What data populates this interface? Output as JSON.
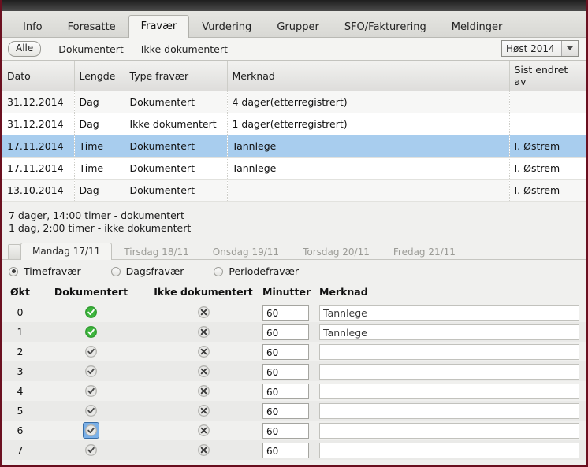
{
  "main_tabs": [
    {
      "label": "Info",
      "active": false
    },
    {
      "label": "Foresatte",
      "active": false
    },
    {
      "label": "Fravær",
      "active": true
    },
    {
      "label": "Vurdering",
      "active": false
    },
    {
      "label": "Grupper",
      "active": false
    },
    {
      "label": "SFO/Fakturering",
      "active": false
    },
    {
      "label": "Meldinger",
      "active": false
    }
  ],
  "filter": {
    "all_label": "Alle",
    "documented_label": "Dokumentert",
    "undocumented_label": "Ikke dokumentert",
    "season": "Høst 2014"
  },
  "grid": {
    "columns": [
      "Dato",
      "Lengde",
      "Type fravær",
      "Merknad",
      "Sist endret av"
    ],
    "rows": [
      {
        "dato": "31.12.2014",
        "lengde": "Dag",
        "type": "Dokumentert",
        "merknad": "4 dager(etterregistrert)",
        "endret": "",
        "selected": false
      },
      {
        "dato": "31.12.2014",
        "lengde": "Dag",
        "type": "Ikke dokumentert",
        "merknad": "1 dager(etterregistrert)",
        "endret": "",
        "selected": false
      },
      {
        "dato": "17.11.2014",
        "lengde": "Time",
        "type": "Dokumentert",
        "merknad": "Tannlege",
        "endret": "I. Østrem",
        "selected": true
      },
      {
        "dato": "17.11.2014",
        "lengde": "Time",
        "type": "Dokumentert",
        "merknad": "Tannlege",
        "endret": "I. Østrem",
        "selected": false
      },
      {
        "dato": "13.10.2014",
        "lengde": "Dag",
        "type": "Dokumentert",
        "merknad": "",
        "endret": "I. Østrem",
        "selected": false
      }
    ]
  },
  "summary": {
    "line1": "7 dager, 14:00 timer - dokumentert",
    "line2": "1 dag, 2:00 timer - ikke dokumentert"
  },
  "day_tabs": [
    {
      "label": "Mandag 17/11",
      "active": true
    },
    {
      "label": "Tirsdag 18/11",
      "active": false
    },
    {
      "label": "Onsdag 19/11",
      "active": false
    },
    {
      "label": "Torsdag 20/11",
      "active": false
    },
    {
      "label": "Fredag 21/11",
      "active": false
    }
  ],
  "absence_type_radios": [
    {
      "label": "Timefravær",
      "selected": true
    },
    {
      "label": "Dagsfravær",
      "selected": false
    },
    {
      "label": "Periodefravær",
      "selected": false
    }
  ],
  "okt": {
    "columns": [
      "Økt",
      "Dokumentert",
      "Ikke dokumentert",
      "Minutter",
      "Merknad"
    ],
    "rows": [
      {
        "okt": "0",
        "documented_state": "on",
        "undocumented_state": "off",
        "focused": false,
        "minutter": "60",
        "merknad": "Tannlege"
      },
      {
        "okt": "1",
        "documented_state": "on",
        "undocumented_state": "off",
        "focused": false,
        "minutter": "60",
        "merknad": "Tannlege"
      },
      {
        "okt": "2",
        "documented_state": "off",
        "undocumented_state": "off",
        "focused": false,
        "minutter": "60",
        "merknad": ""
      },
      {
        "okt": "3",
        "documented_state": "off",
        "undocumented_state": "off",
        "focused": false,
        "minutter": "60",
        "merknad": ""
      },
      {
        "okt": "4",
        "documented_state": "off",
        "undocumented_state": "off",
        "focused": false,
        "minutter": "60",
        "merknad": ""
      },
      {
        "okt": "5",
        "documented_state": "off",
        "undocumented_state": "off",
        "focused": false,
        "minutter": "60",
        "merknad": ""
      },
      {
        "okt": "6",
        "documented_state": "off",
        "undocumented_state": "off",
        "focused": true,
        "minutter": "60",
        "merknad": ""
      },
      {
        "okt": "7",
        "documented_state": "off",
        "undocumented_state": "off",
        "focused": false,
        "minutter": "60",
        "merknad": ""
      }
    ]
  },
  "colors": {
    "frame": "#6b1020",
    "selected_row": "#a8cdee",
    "check_on": "#35a835",
    "check_off": "#9a9a9a",
    "focus": "#7ab0e8"
  }
}
